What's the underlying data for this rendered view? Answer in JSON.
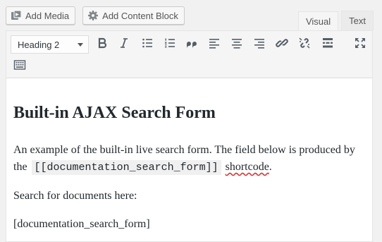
{
  "media_buttons": {
    "add_media": "Add Media",
    "add_content_block": "Add Content Block"
  },
  "tabs": {
    "visual": "Visual",
    "text": "Text",
    "active": "visual"
  },
  "toolbar": {
    "format_select": "Heading 2",
    "buttons": [
      "bold-icon",
      "italic-icon",
      "bulleted-list-icon",
      "numbered-list-icon",
      "blockquote-icon",
      "align-left-icon",
      "align-center-icon",
      "align-right-icon",
      "insert-link-icon",
      "remove-link-icon",
      "read-more-icon",
      "fullscreen-icon",
      "toolbar-toggle-icon"
    ]
  },
  "content": {
    "heading": "Built-in AJAX Search Form",
    "p1_before": "An example of the built-in live search form. The field below is produced by the ",
    "p1_code": "[[documentation_search_form]]",
    "p1_misspelled": "shortcode",
    "p1_after": ".",
    "p2": "Search for documents here:",
    "p3": "[documentation_search_form]"
  },
  "colors": {
    "background": "#f1f1f1",
    "toolbar": "#f5f5f5",
    "icon": "#555d66",
    "spellcheck": "#d63638"
  }
}
